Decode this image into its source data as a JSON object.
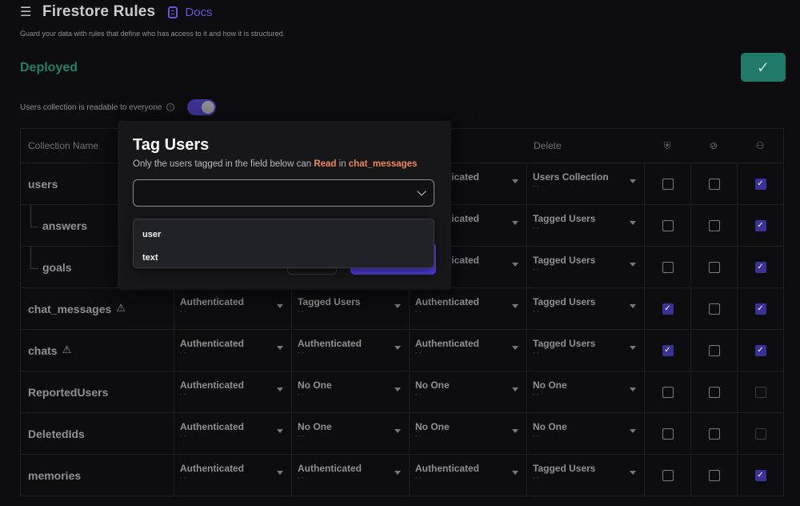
{
  "header": {
    "title": "Firestore Rules",
    "docs_label": "Docs",
    "subtitle": "Guard your data with rules that define who has access to it and how it is structured."
  },
  "status": {
    "label": "Deployed",
    "confirm_icon": "check-icon"
  },
  "toggle": {
    "label": "Users collection is readable to everyone",
    "on": true
  },
  "table": {
    "headers": {
      "name": "Collection Name",
      "delete": "Delete",
      "icon1": "shield-icon",
      "icon2": "no-tag-icon",
      "icon3": "user-remove-icon"
    },
    "rows": [
      {
        "name": "users",
        "sub": false,
        "warn": false,
        "perms": [
          "",
          "",
          "Authenticated",
          "Users Collection"
        ],
        "checks": [
          "off",
          "off",
          "on"
        ]
      },
      {
        "name": "answers",
        "sub": true,
        "warn": false,
        "perms": [
          "",
          "",
          "Authenticated",
          "Tagged Users"
        ],
        "checks": [
          "off",
          "off",
          "on"
        ]
      },
      {
        "name": "goals",
        "sub": true,
        "warn": false,
        "perms": [
          "",
          "",
          "Authenticated",
          "Tagged Users"
        ],
        "checks": [
          "off",
          "off",
          "on"
        ]
      },
      {
        "name": "chat_messages",
        "sub": false,
        "warn": true,
        "perms": [
          "Authenticated",
          "Tagged Users",
          "Authenticated",
          "Tagged Users"
        ],
        "checks": [
          "on",
          "off",
          "on"
        ]
      },
      {
        "name": "chats",
        "sub": false,
        "warn": true,
        "perms": [
          "Authenticated",
          "Authenticated",
          "Authenticated",
          "Tagged Users"
        ],
        "checks": [
          "on",
          "off",
          "on"
        ]
      },
      {
        "name": "ReportedUsers",
        "sub": false,
        "warn": false,
        "perms": [
          "Authenticated",
          "No One",
          "No One",
          "No One"
        ],
        "checks": [
          "off",
          "off",
          "dim"
        ]
      },
      {
        "name": "DeletedIds",
        "sub": false,
        "warn": false,
        "perms": [
          "Authenticated",
          "No One",
          "No One",
          "No One"
        ],
        "checks": [
          "off",
          "off",
          "dim"
        ]
      },
      {
        "name": "memories",
        "sub": false,
        "warn": false,
        "perms": [
          "Authenticated",
          "Authenticated",
          "Authenticated",
          "Tagged Users"
        ],
        "checks": [
          "off",
          "off",
          "on"
        ]
      }
    ],
    "dash": "- -"
  },
  "modal": {
    "title": "Tag Users",
    "desc_prefix": "Only the users tagged in the field below can ",
    "desc_action": "Read",
    "desc_mid": " in ",
    "desc_collection": "chat_messages",
    "select_value": "",
    "options": [
      "user",
      "text"
    ]
  }
}
